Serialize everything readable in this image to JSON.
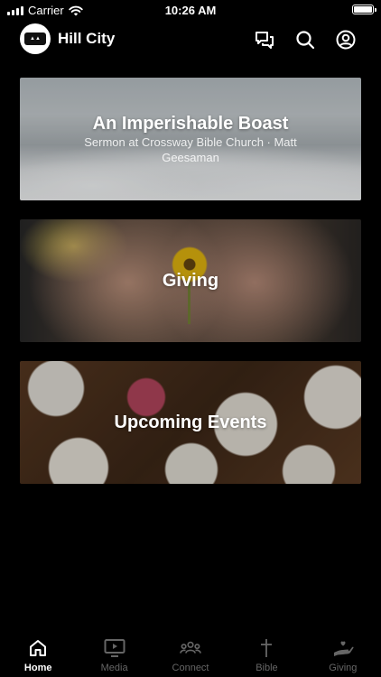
{
  "status_bar": {
    "carrier": "Carrier",
    "time": "10:26 AM",
    "battery_level": 1.0
  },
  "header": {
    "logo_text": "HILL CITY",
    "title": "Hill City",
    "icons": [
      "chat-icon",
      "search-icon",
      "profile-icon"
    ]
  },
  "cards": [
    {
      "title": "An Imperishable Boast",
      "subtitle": "Sermon at Crossway Bible Church · Matt Geesaman"
    },
    {
      "title": "Giving",
      "subtitle": ""
    },
    {
      "title": "Upcoming Events",
      "subtitle": ""
    }
  ],
  "tabs": [
    {
      "label": "Home",
      "icon": "home-icon",
      "active": true
    },
    {
      "label": "Media",
      "icon": "media-icon",
      "active": false
    },
    {
      "label": "Connect",
      "icon": "people-icon",
      "active": false
    },
    {
      "label": "Bible",
      "icon": "cross-icon",
      "active": false
    },
    {
      "label": "Giving",
      "icon": "giving-hand-icon",
      "active": false
    }
  ],
  "colors": {
    "background": "#000000",
    "active_tab": "#ffffff",
    "inactive_tab": "#666666"
  }
}
